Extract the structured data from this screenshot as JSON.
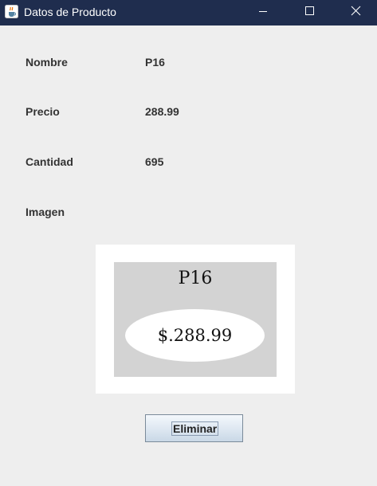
{
  "window": {
    "title": "Datos de Producto",
    "icon": "java-cup-icon",
    "controls": [
      "minimize-icon",
      "maximize-icon",
      "close-icon"
    ],
    "title_bar_color": "#1f2d4e"
  },
  "form": {
    "nombre_label": "Nombre",
    "nombre_value": "P16",
    "precio_label": "Precio",
    "precio_value": "288.99",
    "cantidad_label": "Cantidad",
    "cantidad_value": "695",
    "imagen_label": "Imagen"
  },
  "product_image": {
    "name": "P16",
    "price": "$.288.99"
  },
  "actions": {
    "delete_label": "Eliminar"
  }
}
